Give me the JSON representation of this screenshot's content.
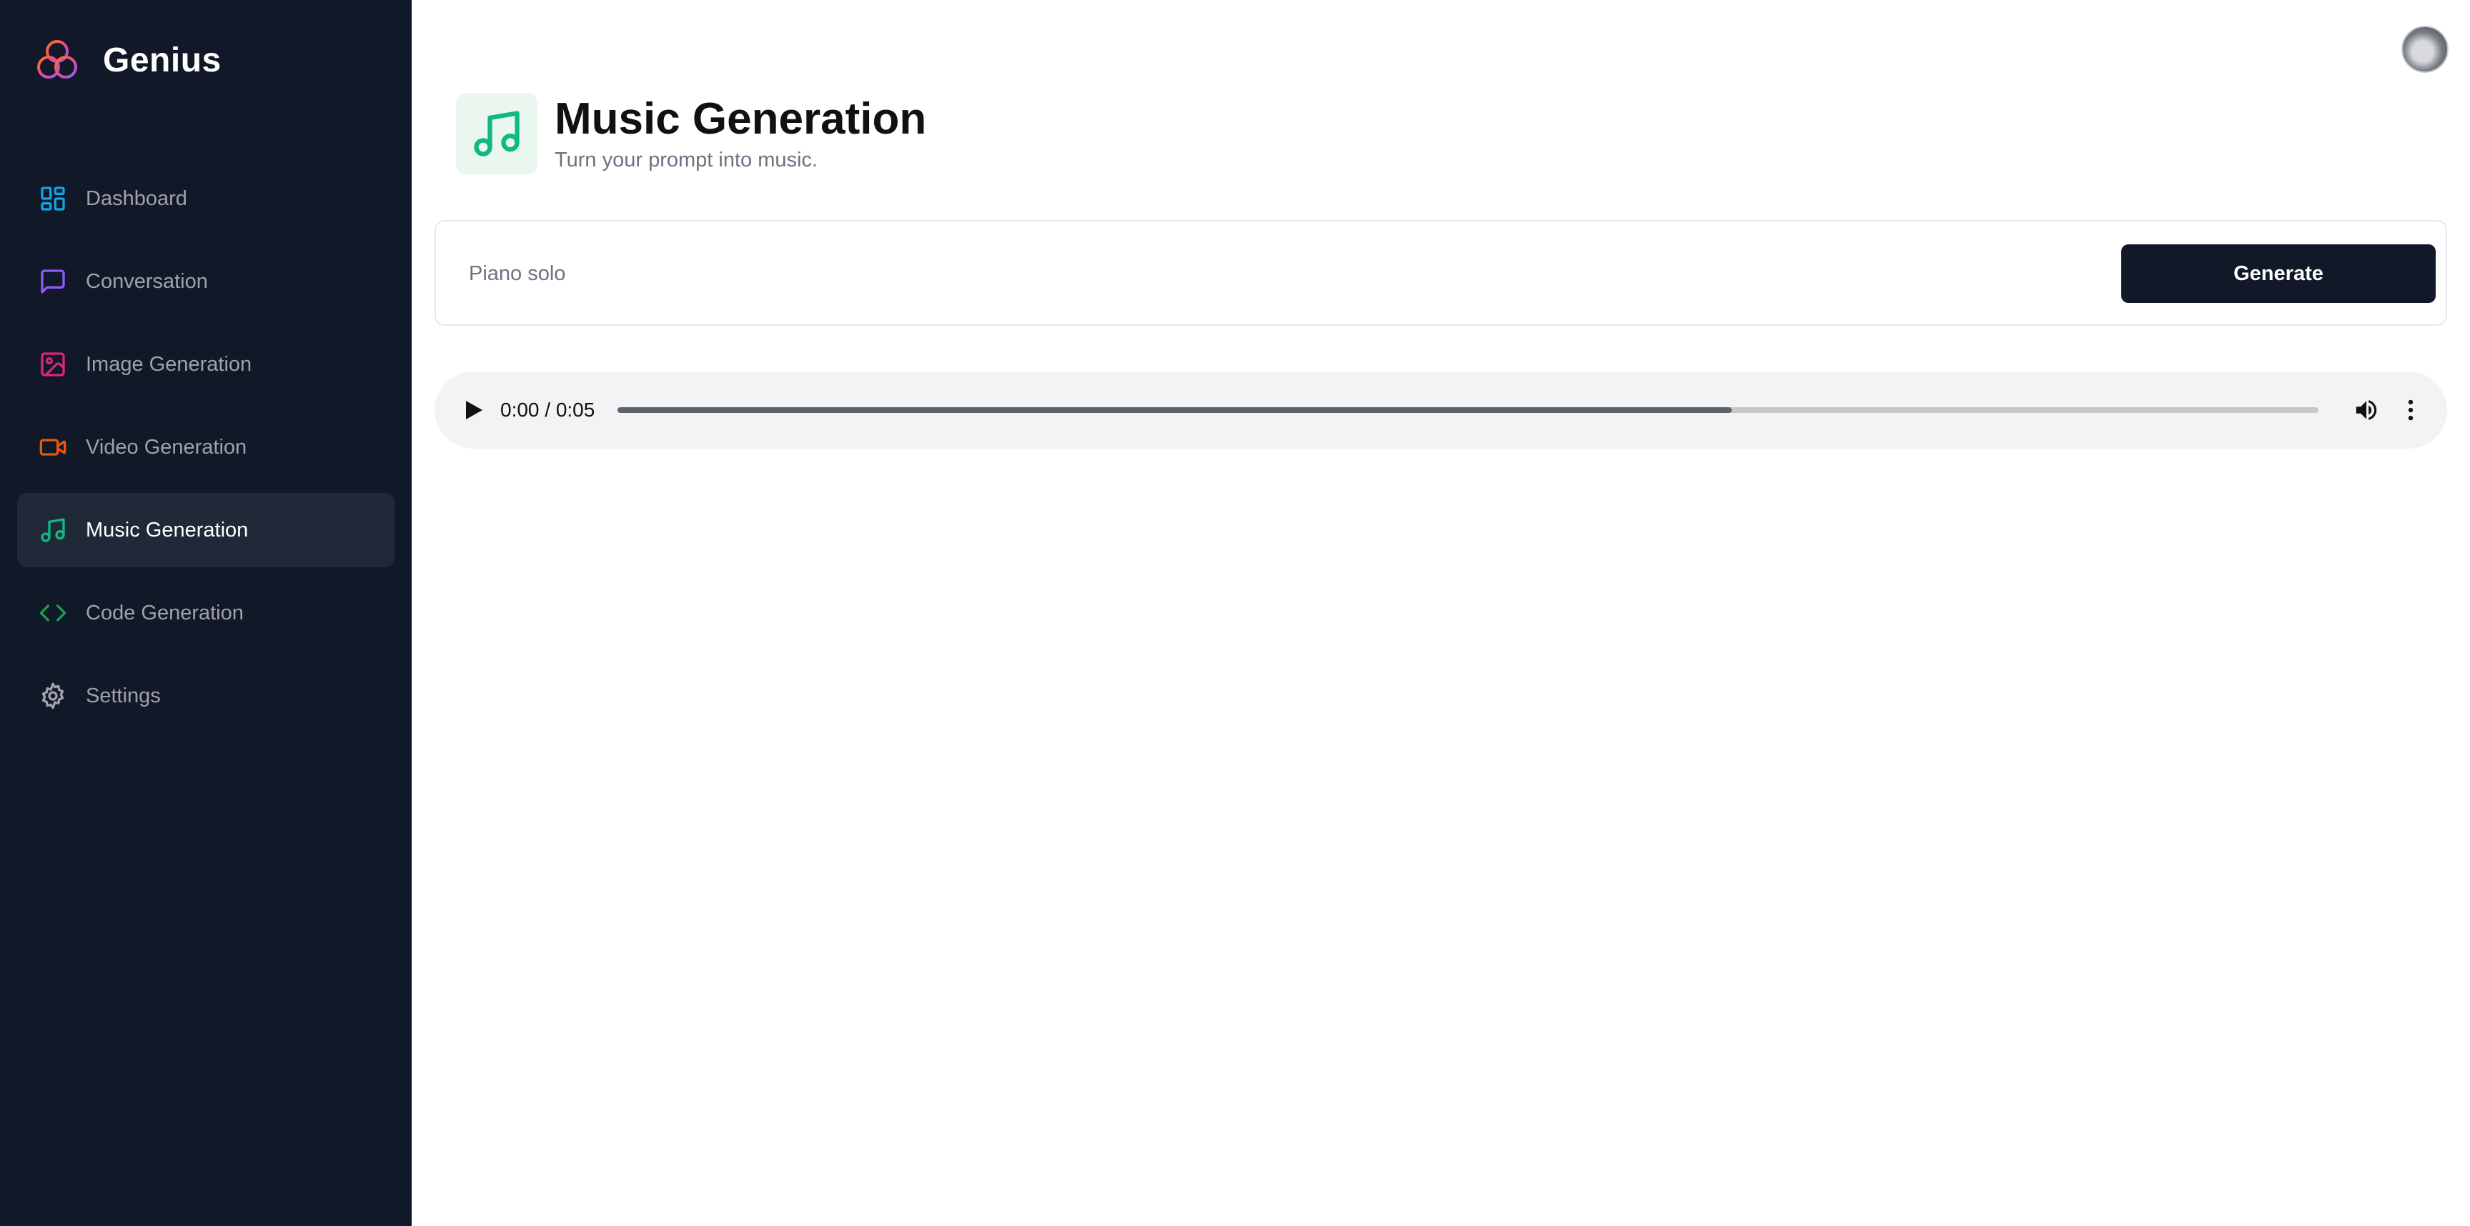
{
  "app": {
    "name": "Genius"
  },
  "sidebar": {
    "items": [
      {
        "label": "Dashboard",
        "icon": "layout-dashboard-icon",
        "color": "#0ea5e9",
        "active": false
      },
      {
        "label": "Conversation",
        "icon": "message-square-icon",
        "color": "#8b5cf6",
        "active": false
      },
      {
        "label": "Image Generation",
        "icon": "image-icon",
        "color": "#db2777",
        "active": false
      },
      {
        "label": "Video Generation",
        "icon": "video-icon",
        "color": "#ea580c",
        "active": false
      },
      {
        "label": "Music Generation",
        "icon": "music-icon",
        "color": "#10b981",
        "active": true
      },
      {
        "label": "Code Generation",
        "icon": "code-icon",
        "color": "#16a34a",
        "active": false
      },
      {
        "label": "Settings",
        "icon": "settings-icon",
        "color": "#a1a1aa",
        "active": false
      }
    ]
  },
  "header": {
    "title": "Music Generation",
    "subtitle": "Turn your prompt into music.",
    "icon": "music-icon",
    "accent": "#10b981"
  },
  "prompt": {
    "value": "Piano solo",
    "generate_label": "Generate"
  },
  "player": {
    "time": "0:00 / 0:05",
    "buffered_fraction": 0.655
  },
  "colors": {
    "sidebar_bg": "#111827",
    "active_item_bg": "#1f2937",
    "button_bg": "#111827"
  }
}
